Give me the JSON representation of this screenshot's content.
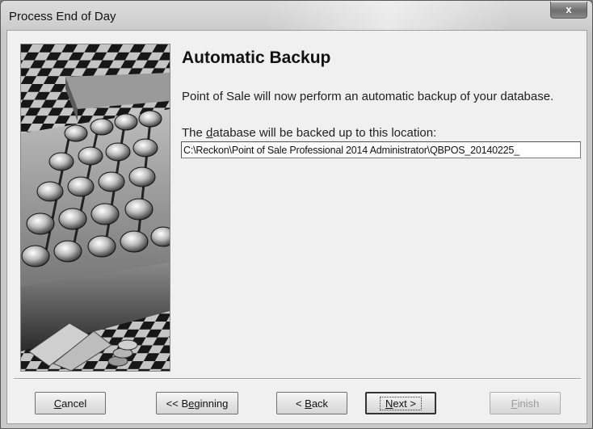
{
  "window": {
    "title": "Process End of Day",
    "close_glyph": "x"
  },
  "main": {
    "heading": "Automatic Backup",
    "description": "Point of Sale will now perform an automatic backup of your database.",
    "location_label_pre": "The ",
    "location_label_accel": "d",
    "location_label_post": "atabase will be backed up to this location:",
    "backup_path": "C:\\Reckon\\Point of Sale Professional 2014 Administrator\\QBPOS_20140225_"
  },
  "buttons": {
    "cancel_accel": "C",
    "cancel_rest": "ancel",
    "beginning_pre": "<< B",
    "beginning_accel": "e",
    "beginning_rest": "ginning",
    "back_pre": "< ",
    "back_accel": "B",
    "back_rest": "ack",
    "next_accel": "N",
    "next_rest": "ext >",
    "finish_accel": "F",
    "finish_rest": "inish"
  },
  "icons": {
    "close": "close-icon",
    "illustration": "cash-register-illustration"
  }
}
